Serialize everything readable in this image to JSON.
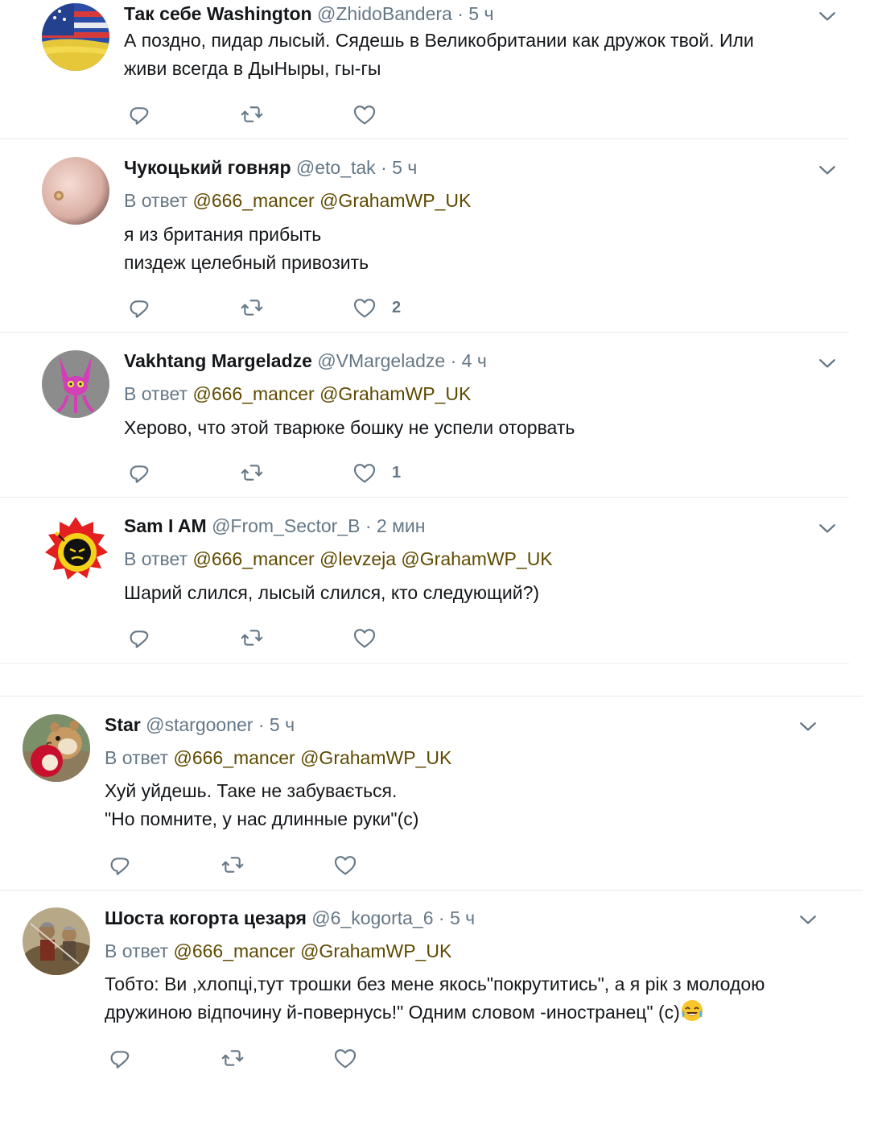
{
  "tweets": [
    {
      "name": "Так себе Washington",
      "handle": "@ZhidoBandera",
      "dot": "·",
      "time": "5 ч",
      "reply_prefix": "",
      "mentions": [],
      "lines": [
        "А поздно, пидар лысый. Сядешь в Великобритании как дружок твой. Или",
        "живи всегда в ДыНыры, гы-гы"
      ],
      "likes": ""
    },
    {
      "name": "Чукоцький говняр",
      "handle": "@eto_tak",
      "dot": "·",
      "time": "5 ч",
      "reply_prefix": "В ответ",
      "mentions": [
        "@666_mancer",
        "@GrahamWP_UK"
      ],
      "lines": [
        "я из британия прибыть",
        "пиздеж целебный привозить"
      ],
      "likes": "2"
    },
    {
      "name": "Vakhtang Margeladze",
      "handle": "@VMargeladze",
      "dot": "·",
      "time": "4 ч",
      "reply_prefix": "В ответ",
      "mentions": [
        "@666_mancer",
        "@GrahamWP_UK"
      ],
      "lines": [
        "Херово, что этой тварюке бошку не успели оторвать"
      ],
      "likes": "1"
    },
    {
      "name": "Sam I AM",
      "handle": "@From_Sector_B",
      "dot": "·",
      "time": "2 мин",
      "reply_prefix": "В ответ",
      "mentions": [
        "@666_mancer",
        "@levzeja",
        "@GrahamWP_UK"
      ],
      "lines": [
        "Шарий слился, лысый слился, кто следующий?)"
      ],
      "likes": ""
    },
    {
      "name": "Star",
      "handle": "@stargooner",
      "dot": "·",
      "time": "5 ч",
      "reply_prefix": "В ответ",
      "mentions": [
        "@666_mancer",
        "@GrahamWP_UK"
      ],
      "lines": [
        "Хуй уйдешь. Таке не забувається.",
        "\"Но помните, у нас длинные руки\"(с)"
      ],
      "likes": ""
    },
    {
      "name": "Шоста когорта цезаря",
      "handle": "@6_kogorta_6",
      "dot": "·",
      "time": "5 ч",
      "reply_prefix": "В ответ",
      "mentions": [
        "@666_mancer",
        "@GrahamWP_UK"
      ],
      "lines": [
        "Тобто: Ви ,хлопці,тут трошки без мене якось\"покрутитись\", а я рік з молодою",
        "дружиною відпочину й-повернусь!\" Одним словом -иностранец\" (с)"
      ],
      "emoji_icon": "face-with-tears-of-joy-emoji",
      "likes": ""
    }
  ],
  "icons": {
    "reply": "reply-icon",
    "retweet": "retweet-icon",
    "like": "heart-icon",
    "more": "chevron-down-icon"
  },
  "colors": {
    "text": "#14171a",
    "secondary": "#657786",
    "mention": "#5f4a00",
    "separator": "#e6ecf0"
  }
}
